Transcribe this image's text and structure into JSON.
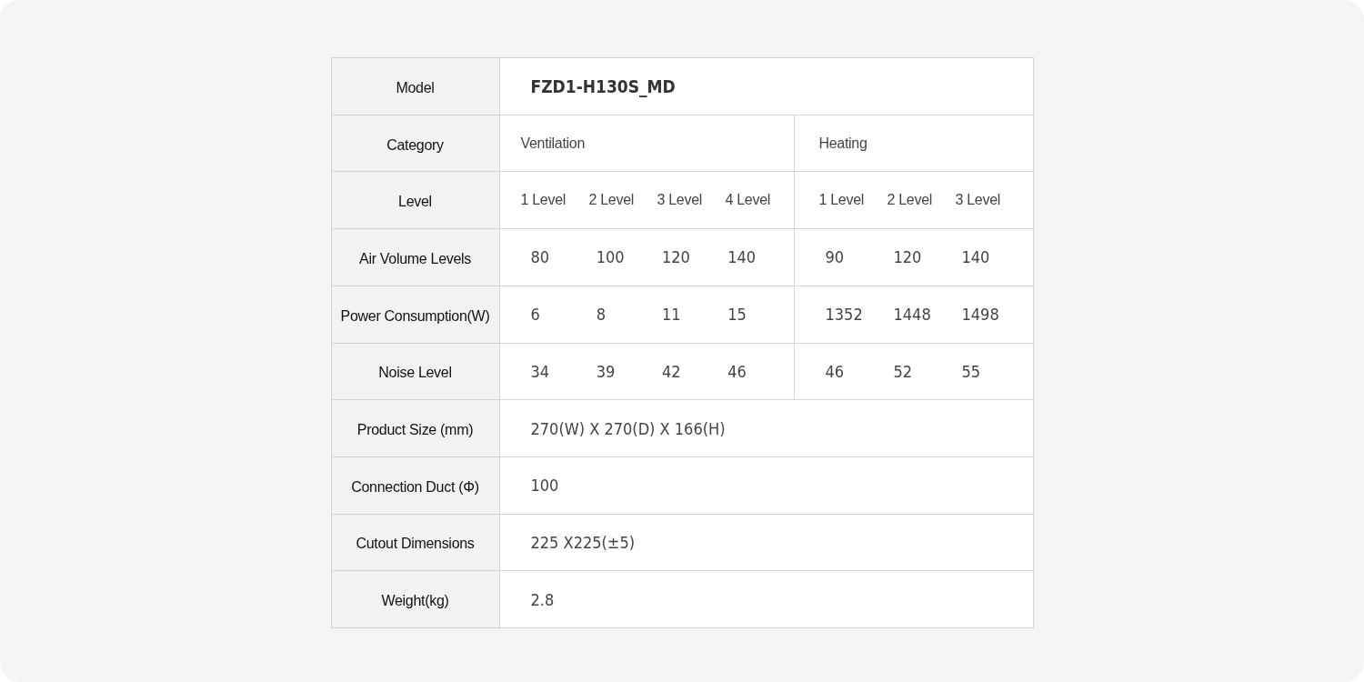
{
  "table": {
    "rows": [
      {
        "label": "Model",
        "kind": "heading",
        "value": "FZD1-H130S_MD"
      },
      {
        "label": "Category",
        "kind": "split",
        "groups": [
          [
            "Ventilation"
          ],
          [
            "Heating"
          ]
        ]
      },
      {
        "label": "Level",
        "kind": "split",
        "groups": [
          [
            "1 Level",
            "2 Level",
            "3 Level",
            "4 Level"
          ],
          [
            "1 Level",
            "2 Level",
            "3 Level"
          ]
        ]
      },
      {
        "label": "Air Volume Levels",
        "kind": "split",
        "groups": [
          [
            "80",
            "100",
            "120",
            "140"
          ],
          [
            "90",
            "120",
            "140"
          ]
        ]
      },
      {
        "label": "Power Consumption(W)",
        "kind": "split",
        "groups": [
          [
            "6",
            "8",
            "11",
            "15"
          ],
          [
            "1352",
            "1448",
            "1498"
          ]
        ]
      },
      {
        "label": "Noise Level",
        "kind": "split",
        "groups": [
          [
            "34",
            "39",
            "42",
            "46"
          ],
          [
            "46",
            "52",
            "55"
          ]
        ]
      },
      {
        "label": "Product Size (mm)",
        "kind": "single",
        "value": "270(W) X 270(D) X 166(H)"
      },
      {
        "label": "Connection Duct (Φ)",
        "kind": "single",
        "value": "100"
      },
      {
        "label": "Cutout Dimensions",
        "kind": "single",
        "value": "225 X225(±5)"
      },
      {
        "label": "Weight(kg)",
        "kind": "single",
        "value": "2.8"
      }
    ]
  }
}
